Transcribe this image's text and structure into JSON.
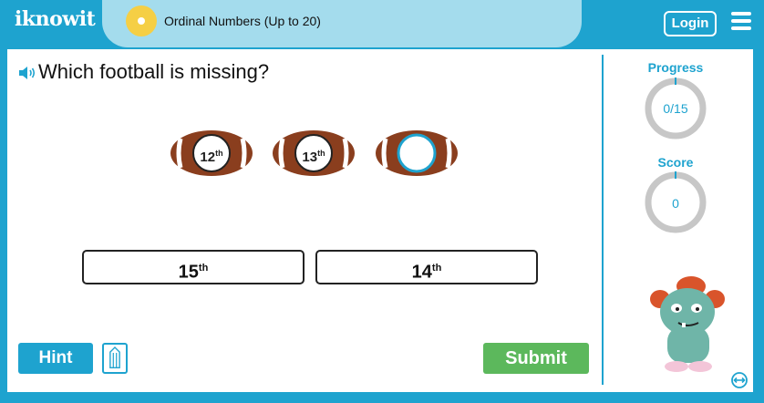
{
  "header": {
    "logo_text": "iknowit",
    "topic": "Ordinal Numbers (Up to 20)",
    "login_label": "Login"
  },
  "question": {
    "text": "Which football is missing?"
  },
  "footballs": [
    {
      "number": "12",
      "suffix": "th"
    },
    {
      "number": "13",
      "suffix": "th"
    },
    {
      "number": "",
      "suffix": ""
    }
  ],
  "answers": [
    {
      "number": "15",
      "suffix": "th"
    },
    {
      "number": "14",
      "suffix": "th"
    }
  ],
  "buttons": {
    "hint_label": "Hint",
    "submit_label": "Submit"
  },
  "sidebar": {
    "progress_label": "Progress",
    "progress_value": "0/15",
    "score_label": "Score",
    "score_value": "0"
  },
  "colors": {
    "brand": "#1ea3cf",
    "submit": "#5cb85c",
    "pill": "#a4dced",
    "football": "#8a3e1e"
  }
}
